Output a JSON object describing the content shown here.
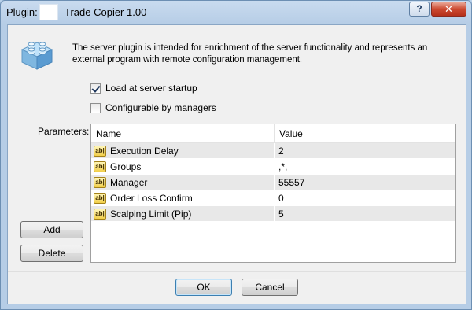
{
  "window": {
    "title_prefix": "Plugin:",
    "title": "Trade Copier 1.00",
    "help_label": "?",
    "close_label": "✕"
  },
  "description": "The server plugin is intended for enrichment of the server functionality and represents an external program with remote configuration management.",
  "options": {
    "load_at_startup": {
      "label": "Load at server startup",
      "checked": true
    },
    "configurable_by_managers": {
      "label": "Configurable by managers",
      "checked": false
    }
  },
  "parameters": {
    "label": "Parameters:",
    "columns": [
      "Name",
      "Value"
    ],
    "icon_text": "ab|",
    "rows": [
      {
        "name": "Execution Delay",
        "value": "2"
      },
      {
        "name": "Groups",
        "value": ",*,"
      },
      {
        "name": "Manager",
        "value": "55557"
      },
      {
        "name": "Order Loss Confirm",
        "value": "0"
      },
      {
        "name": "Scalping Limit (Pip)",
        "value": "5"
      }
    ]
  },
  "buttons": {
    "add": "Add",
    "delete": "Delete",
    "ok": "OK",
    "cancel": "Cancel"
  },
  "colors": {
    "title_bar": "#b6cde6",
    "close_button": "#cc4a31",
    "row_alt": "#e8e8e8",
    "plugin_icon": "#8fc4ea"
  },
  "icons": {
    "plugin": "lego-brick-icon",
    "help": "question-icon",
    "close": "close-icon",
    "param": "text-value-icon"
  }
}
